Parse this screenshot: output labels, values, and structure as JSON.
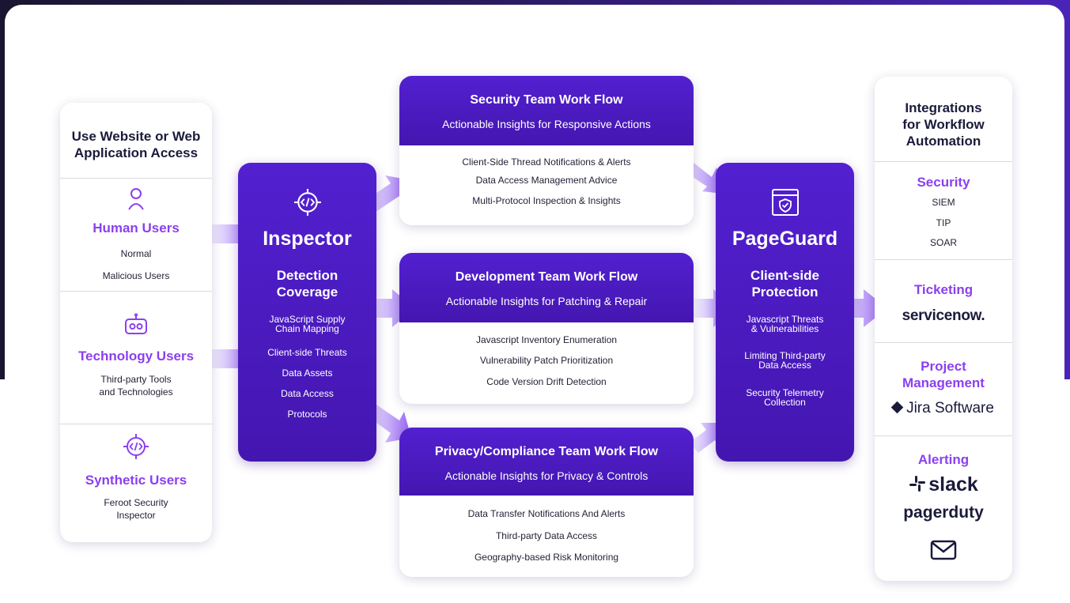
{
  "users": {
    "title": "Use Website or Web Application Access",
    "human": {
      "label": "Human Users",
      "items": [
        "Normal",
        "Malicious Users"
      ]
    },
    "technology": {
      "label": "Technology Users",
      "items": [
        "Third-party Tools",
        "and Technologies"
      ]
    },
    "synthetic": {
      "label": "Synthetic Users",
      "items": [
        "Feroot Security",
        "Inspector"
      ]
    }
  },
  "inspector": {
    "title": "Inspector",
    "subtitle": [
      "Detection",
      "Coverage"
    ],
    "items": [
      "JavaScript Supply",
      "Chain Mapping",
      "Client-side Threats",
      "Data Assets",
      "Data Access",
      "Protocols"
    ]
  },
  "workflows": [
    {
      "title": "Security Team Work Flow",
      "subtitle": "Actionable Insights for Responsive Actions",
      "items": [
        "Client-Side Thread Notifications & Alerts",
        "Data Access Management Advice",
        "Multi-Protocol Inspection & Insights"
      ]
    },
    {
      "title": "Development Team Work Flow",
      "subtitle": "Actionable Insights for Patching & Repair",
      "items": [
        "Javascript Inventory Enumeration",
        "Vulnerability Patch Prioritization",
        "Code Version Drift Detection"
      ]
    },
    {
      "title": "Privacy/Compliance Team Work Flow",
      "subtitle": "Actionable Insights for Privacy & Controls",
      "items": [
        "Data Transfer Notifications And Alerts",
        "Third-party Data Access",
        "Geography-based Risk Monitoring"
      ]
    }
  ],
  "pageguard": {
    "title": "PageGuard",
    "subtitle": [
      "Client-side",
      "Protection"
    ],
    "items": [
      "Javascript Threats",
      "& Vulnerabilities",
      "Limiting Third-party",
      "Data Access",
      "Security Telemetry",
      "Collection"
    ]
  },
  "integrations": {
    "title": [
      "Integrations",
      "for Workflow",
      "Automation"
    ],
    "security": {
      "label": "Security",
      "items": [
        "SIEM",
        "TIP",
        "SOAR"
      ]
    },
    "ticketing": {
      "label": "Ticketing",
      "logo": "servicenow."
    },
    "project": {
      "label": [
        "Project",
        "Management"
      ],
      "logo": "Jira Software"
    },
    "alerting": {
      "label": "Alerting",
      "logos": [
        "slack",
        "pagerduty"
      ]
    }
  },
  "icons": {
    "user": "user-icon",
    "robot": "robot-icon",
    "code": "code-target-icon",
    "shield": "shield-window-icon",
    "mail": "mail-icon",
    "slack": "slack-icon",
    "jira": "jira-diamond-icon"
  },
  "colors": {
    "purple": "#4a1bc1",
    "accent": "#8b3ff0",
    "text": "#1a1b3a"
  }
}
